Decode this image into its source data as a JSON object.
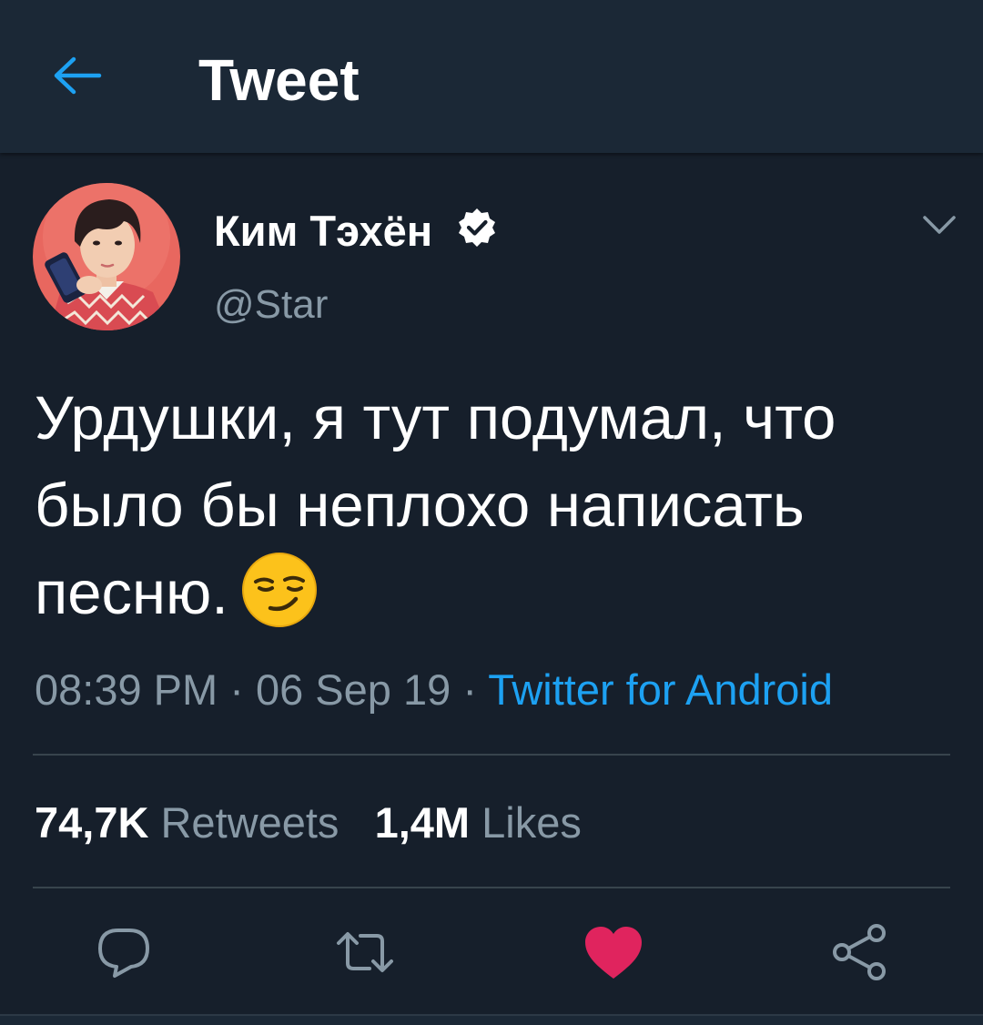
{
  "header": {
    "title": "Tweet",
    "back_icon": "arrow-left-icon"
  },
  "tweet": {
    "author": {
      "name": "Ким Тэхён",
      "handle": "@Star",
      "verified": true
    },
    "text": "Урдушки, я тут подумал, что было бы неплохо написать песню.",
    "emoji": "smirking-face-icon",
    "time": "08:39 PM",
    "separator": "·",
    "date": "06 Sep 19",
    "source": "Twitter for Android",
    "stats": {
      "retweets_count": "74,7K",
      "retweets_label": "Retweets",
      "likes_count": "1,4M",
      "likes_label": "Likes"
    },
    "liked": true
  },
  "colors": {
    "background": "#161f2b",
    "header_bg": "#1b2836",
    "accent": "#1da1f2",
    "secondary_text": "#8899a6",
    "like": "#e0245e"
  }
}
